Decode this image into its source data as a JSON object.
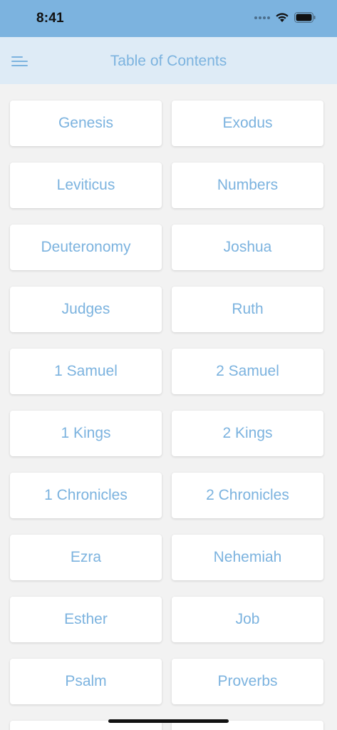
{
  "status_bar": {
    "time": "8:41",
    "icons": [
      "signal-icon",
      "wifi-icon",
      "battery-icon"
    ]
  },
  "nav": {
    "title": "Table of Contents",
    "menu_icon": "menu-icon"
  },
  "colors": {
    "accent": "#7cb3df",
    "nav_bg": "#deebf6",
    "status_bg": "#7cb3df",
    "page_bg": "#f2f2f2"
  },
  "books": [
    "Genesis",
    "Exodus",
    "Leviticus",
    "Numbers",
    "Deuteronomy",
    "Joshua",
    "Judges",
    "Ruth",
    "1 Samuel",
    "2 Samuel",
    "1 Kings",
    "2 Kings",
    "1 Chronicles",
    "2 Chronicles",
    "Ezra",
    "Nehemiah",
    "Esther",
    "Job",
    "Psalm",
    "Proverbs",
    "",
    ""
  ]
}
